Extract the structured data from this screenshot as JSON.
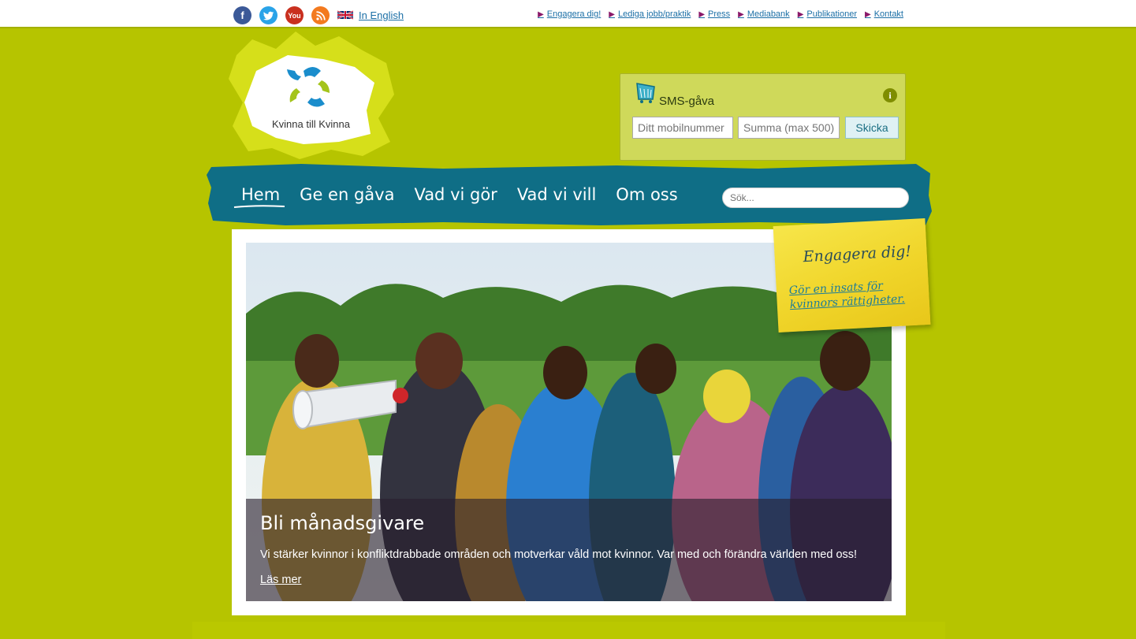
{
  "topbar": {
    "social": [
      {
        "name": "facebook",
        "glyph": "f",
        "color": "#3b5998"
      },
      {
        "name": "twitter",
        "glyph": "t",
        "color": "#2aa3e8"
      },
      {
        "name": "youtube",
        "glyph": "You",
        "color": "#c9301f"
      },
      {
        "name": "rss",
        "glyph": "",
        "color": "#f37a1f"
      }
    ],
    "english_label": "In English",
    "links": [
      "Engagera dig!",
      "Lediga jobb/praktik",
      "Press",
      "Mediabank",
      "Publikationer",
      "Kontakt"
    ]
  },
  "logo": {
    "text": "Kvinna till Kvinna"
  },
  "sms": {
    "title": "SMS-gåva",
    "info_glyph": "i",
    "phone_placeholder": "Ditt mobilnummer",
    "amount_placeholder": "Summa (max 500)",
    "button": "Skicka"
  },
  "nav": {
    "items": [
      "Hem",
      "Ge en gåva",
      "Vad vi gör",
      "Vad vi vill",
      "Om oss"
    ],
    "search_placeholder": "Sök..."
  },
  "hero": {
    "title": "Bli månadsgivare",
    "description": "Vi stärker kvinnor i konfliktdrabbade områden och motverkar våld mot kvinnor. Var med och förändra världen med oss!",
    "link": "Läs mer"
  },
  "postit": {
    "title": "Engagera dig!",
    "link_line1": "Gör en insats för",
    "link_line2": "kvinnors rättigheter",
    "trailing": "."
  },
  "colors": {
    "background": "#b6c400",
    "nav": "#0f6e86",
    "accent": "#8b1a6a"
  }
}
